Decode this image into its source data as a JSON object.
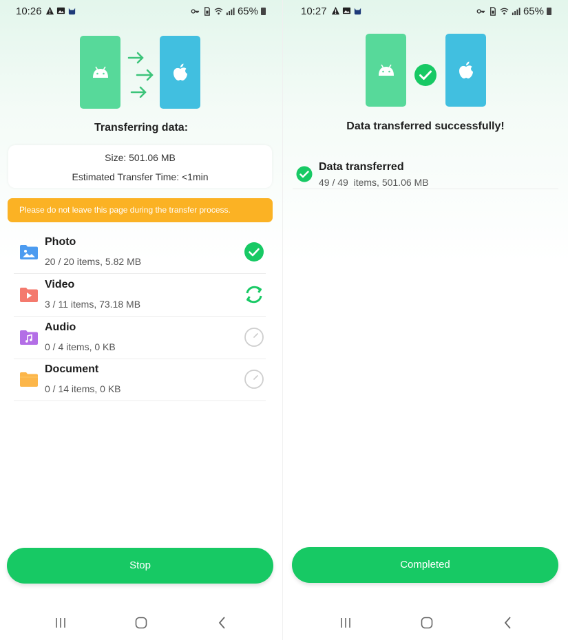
{
  "left_screen": {
    "status_bar": {
      "time": "10:26",
      "battery": "65%",
      "left_icons": [
        "warning-icon",
        "gallery-icon",
        "cat-icon"
      ],
      "right_icons": [
        "vpn-key-icon",
        "sim-icon",
        "wifi-icon",
        "signal-icon",
        "battery-icon"
      ]
    },
    "heading": "Transferring data:",
    "info": {
      "size": "Size: 501.06 MB",
      "eta": "Estimated Transfer Time: <1min"
    },
    "warning": "Please do not leave this page during the transfer process.",
    "items": [
      {
        "title": "Photo",
        "detail": "20 / 20 items, 5.82 MB",
        "state": "done",
        "icon": "photo-folder-icon"
      },
      {
        "title": "Video",
        "detail": "3 / 11 items, 73.18 MB",
        "state": "in-progress",
        "icon": "video-folder-icon"
      },
      {
        "title": "Audio",
        "detail": "0 / 4 items, 0 KB",
        "state": "pending",
        "icon": "audio-folder-icon"
      },
      {
        "title": "Document",
        "detail": "0 / 14 items, 0 KB",
        "state": "pending",
        "icon": "document-folder-icon"
      }
    ],
    "button_label": "Stop"
  },
  "right_screen": {
    "status_bar": {
      "time": "10:27",
      "battery": "65%",
      "left_icons": [
        "warning-icon",
        "gallery-icon",
        "cat-icon"
      ],
      "right_icons": [
        "vpn-key-icon",
        "sim-icon",
        "wifi-icon",
        "signal-icon",
        "battery-icon"
      ]
    },
    "heading": "Data transferred successfully!",
    "result": {
      "title": "Data transferred",
      "detail": "49 / 49  items, 501.06 MB"
    },
    "button_label": "Completed"
  },
  "colors": {
    "accent_green": "#17c964",
    "android_phone": "#57d99a",
    "apple_phone": "#41bfe0",
    "warning": "#fbb224"
  }
}
